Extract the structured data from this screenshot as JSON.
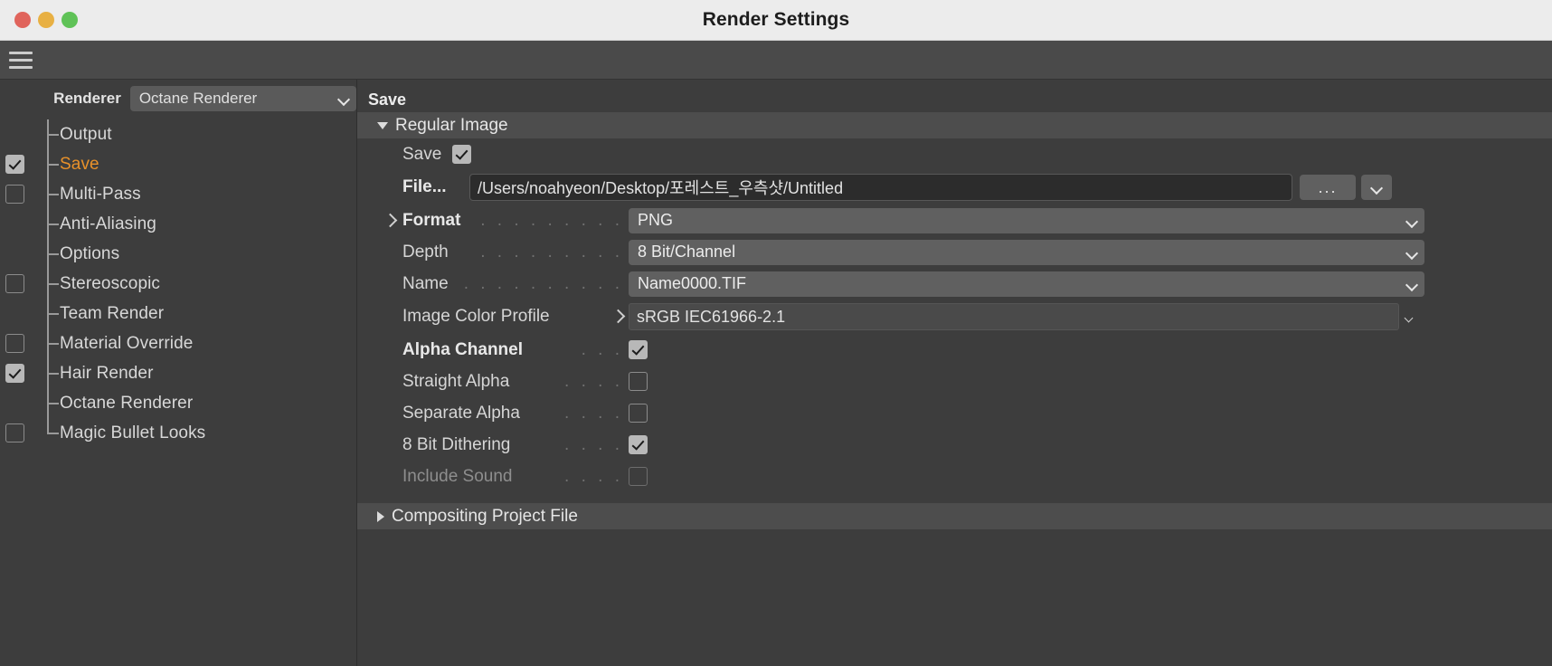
{
  "window": {
    "title": "Render Settings",
    "traffic_lights": [
      "close-red",
      "minimize-yellow",
      "maximize-green"
    ],
    "menu_icon": "hamburger-icon"
  },
  "left_pane": {
    "renderer": {
      "label": "Renderer",
      "value": "Octane Renderer",
      "chevron": "chevron-down-icon"
    },
    "tree": [
      {
        "label": "Output",
        "checkbox": "none",
        "selected": false
      },
      {
        "label": "Save",
        "checkbox": "on",
        "selected": true
      },
      {
        "label": "Multi-Pass",
        "checkbox": "off",
        "selected": false
      },
      {
        "label": "Anti-Aliasing",
        "checkbox": "none",
        "selected": false
      },
      {
        "label": "Options",
        "checkbox": "none",
        "selected": false
      },
      {
        "label": "Stereoscopic",
        "checkbox": "off",
        "selected": false
      },
      {
        "label": "Team Render",
        "checkbox": "none",
        "selected": false
      },
      {
        "label": "Material Override",
        "checkbox": "off",
        "selected": false
      },
      {
        "label": "Hair Render",
        "checkbox": "on",
        "selected": false
      },
      {
        "label": "Octane Renderer",
        "checkbox": "none",
        "selected": false
      },
      {
        "label": "Magic Bullet Looks",
        "checkbox": "off",
        "selected": false
      }
    ]
  },
  "right_pane": {
    "title": "Save",
    "groups": [
      {
        "label": "Regular Image",
        "expanded": true
      },
      {
        "label": "Compositing Project File",
        "expanded": false
      }
    ],
    "fields": {
      "save": {
        "label": "Save",
        "checked": true
      },
      "file": {
        "label": "File...",
        "value": "/Users/noahyeon/Desktop/포레스트_우측샷/Untitled",
        "browse_button": "...",
        "dropdown": "chevron-down-icon"
      },
      "format": {
        "label": "Format",
        "dots": ". . . . . . . . .",
        "value": "PNG",
        "expandable": true
      },
      "depth": {
        "label": "Depth",
        "dots": ". . . . . . . . .",
        "value": "8 Bit/Channel"
      },
      "name": {
        "label": "Name",
        "dots": ". . . . . . . . . .",
        "value": "Name0000.TIF"
      },
      "color_profile": {
        "label": "Image Color Profile",
        "value": "sRGB IEC61966-2.1",
        "expandable": true
      },
      "alpha_channel": {
        "label": "Alpha Channel",
        "dots": ". . .",
        "checked": true,
        "bold": true
      },
      "straight_alpha": {
        "label": "Straight Alpha",
        "dots": ". . . .",
        "checked": false,
        "bold": false
      },
      "separate_alpha": {
        "label": "Separate Alpha",
        "dots": ". . . .",
        "checked": false,
        "bold": false
      },
      "dithering": {
        "label": "8 Bit Dithering",
        "dots": ". . . .",
        "checked": true,
        "bold": false
      },
      "include_sound": {
        "label": "Include Sound",
        "dots": ". . . .",
        "checked": false,
        "bold": false,
        "disabled": true
      }
    }
  },
  "colors": {
    "accent_selected": "#e8912a",
    "panel_bg": "#3d3d3d",
    "group_header_bg": "#4d4d4d",
    "dropdown_bg": "#606060",
    "titlebar_bg": "#ececec"
  }
}
